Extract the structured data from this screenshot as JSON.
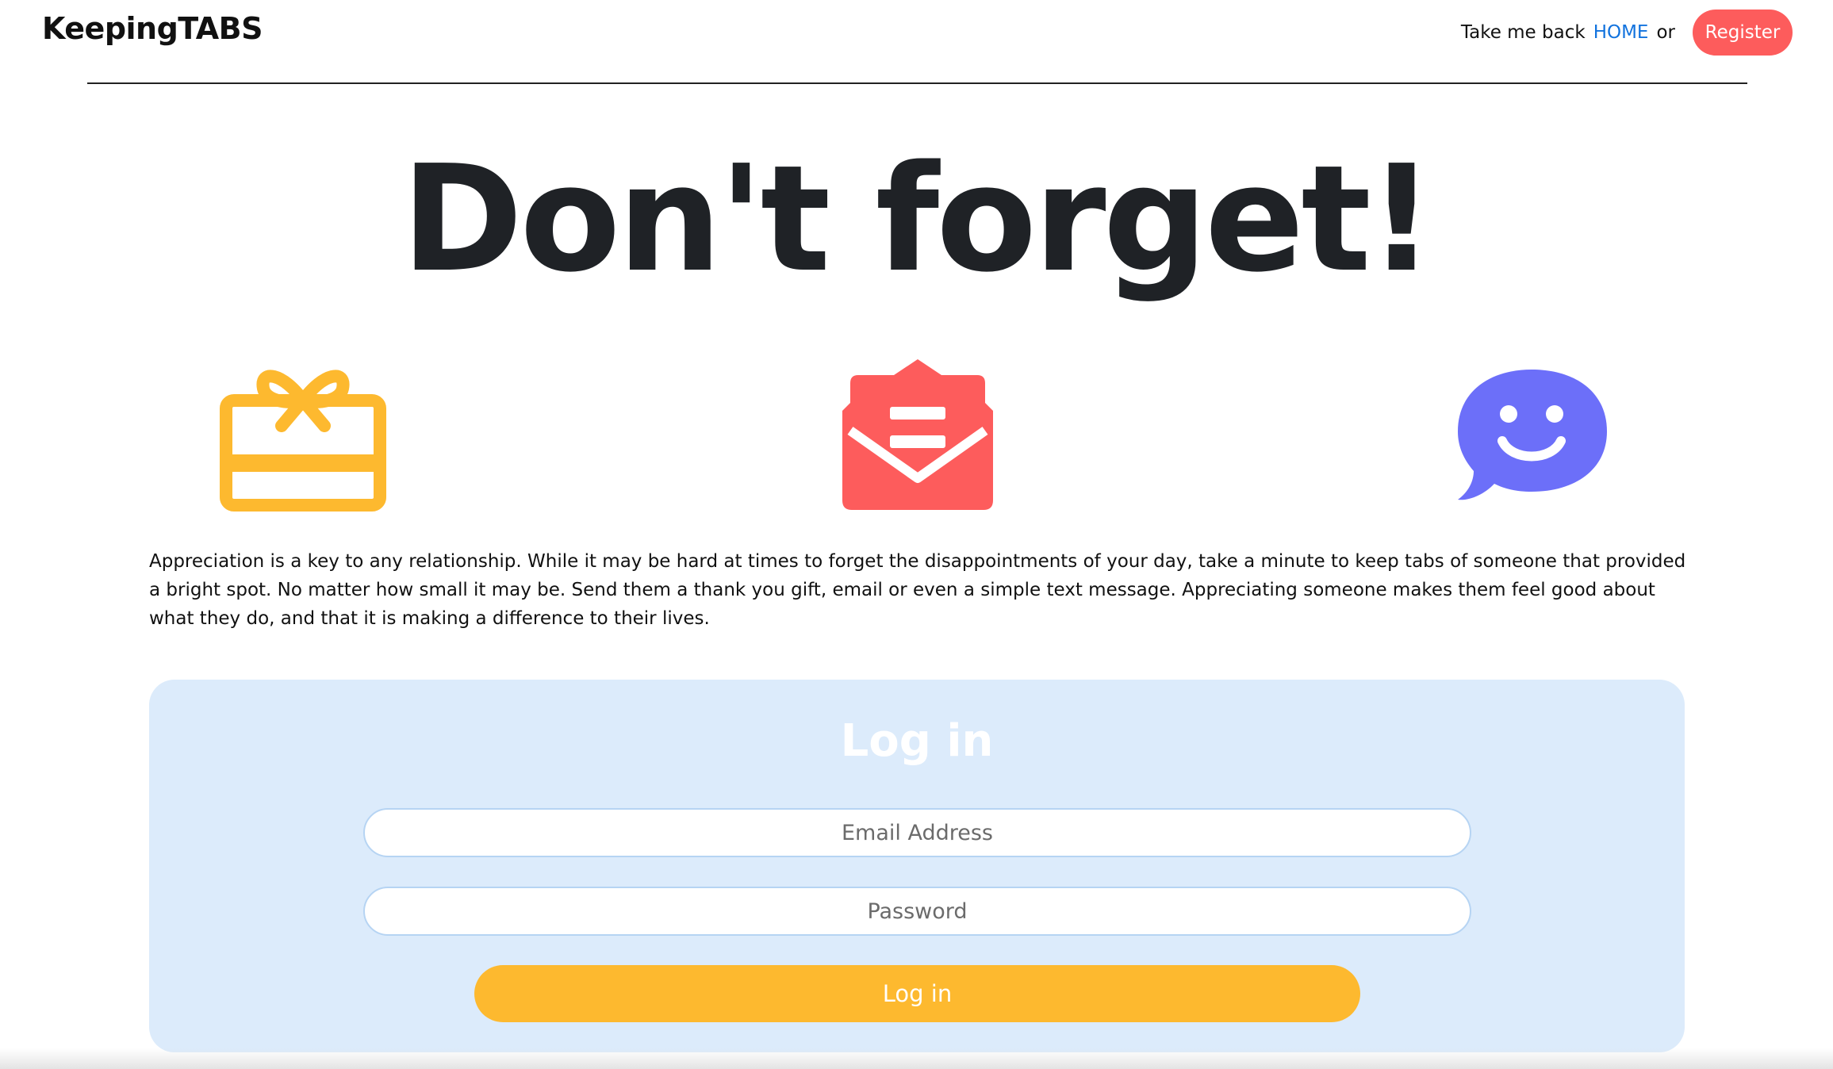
{
  "header": {
    "brand": "KeepingTABS",
    "nav_prefix": "Take me back",
    "home_link": "HOME",
    "nav_or": "or",
    "register_label": "Register"
  },
  "hero": {
    "title": "Don't forget!"
  },
  "icons": {
    "gift": {
      "name": "gift-icon",
      "color": "#fdb92f"
    },
    "mail": {
      "name": "open-envelope-icon",
      "color": "#fd5c5c"
    },
    "chat": {
      "name": "smiley-chat-bubble-icon",
      "color": "#6c6ff9"
    }
  },
  "intro": {
    "text": "Appreciation is a key to any relationship. While it may be hard at times to forget the disappointments of your day, take a minute to keep tabs of someone that provided a bright spot. No matter how small it may be. Send them a thank you gift, email or even a simple text message. Appreciating someone makes them feel good about what they do, and that it is making a difference to their lives."
  },
  "login": {
    "title": "Log in",
    "email_placeholder": "Email Address",
    "password_placeholder": "Password",
    "submit_label": "Log in"
  },
  "colors": {
    "accent_yellow": "#fdb92f",
    "accent_red": "#fd5c5c",
    "accent_purple": "#6c6ff9",
    "card_bg": "#dcebfb",
    "link_blue": "#1273de"
  }
}
